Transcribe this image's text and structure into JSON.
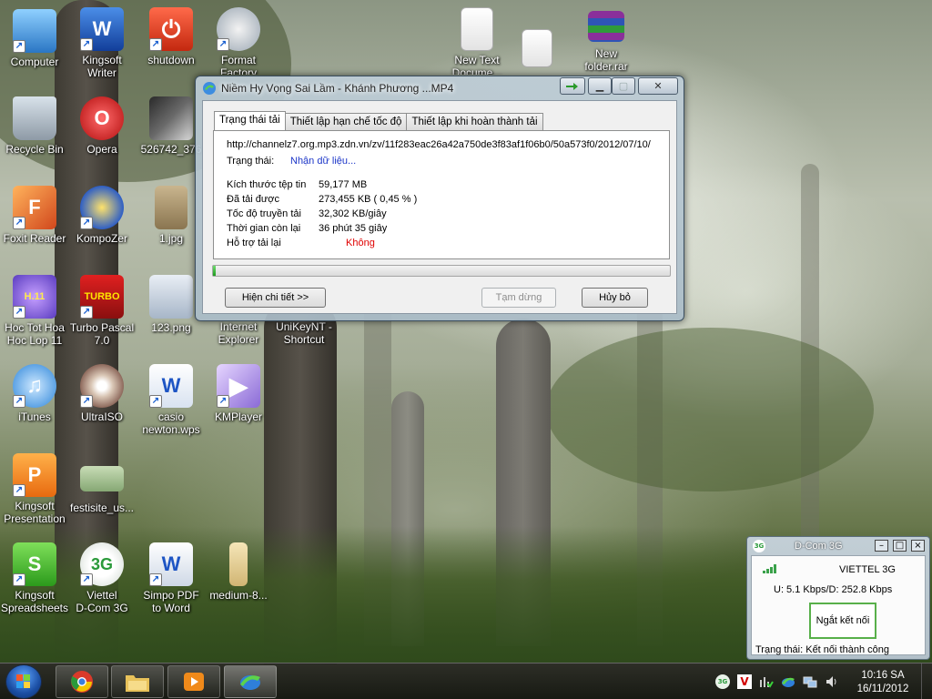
{
  "desktop": {
    "icons": [
      {
        "label": "Computer",
        "label2": ""
      },
      {
        "label": "Kingsoft",
        "label2": "Writer"
      },
      {
        "label": "shutdown",
        "label2": ""
      },
      {
        "label": "Format",
        "label2": "Factory"
      },
      {
        "label": "New Text",
        "label2": "Docume..."
      },
      {
        "label": "",
        "label2": ""
      },
      {
        "label": "New",
        "label2": "folder.rar"
      },
      {
        "label": "Recycle Bin",
        "label2": ""
      },
      {
        "label": "Opera",
        "label2": ""
      },
      {
        "label": "526742_376",
        "label2": ""
      },
      {
        "label": "Foxit Reader",
        "label2": ""
      },
      {
        "label": "KompoZer",
        "label2": ""
      },
      {
        "label": "1.jpg",
        "label2": ""
      },
      {
        "label": "Hoc Tot Hoa",
        "label2": "Hoc Lop 11"
      },
      {
        "label": "Turbo Pascal",
        "label2": "7.0"
      },
      {
        "label": "123.png",
        "label2": ""
      },
      {
        "label": "Internet",
        "label2": "Explorer"
      },
      {
        "label": "UniKeyNT -",
        "label2": "Shortcut"
      },
      {
        "label": "iTunes",
        "label2": ""
      },
      {
        "label": "UltraISO",
        "label2": ""
      },
      {
        "label": "casio",
        "label2": "newton.wps"
      },
      {
        "label": "KMPlayer",
        "label2": ""
      },
      {
        "label": "Kingsoft",
        "label2": "Presentation"
      },
      {
        "label": "festisite_us...",
        "label2": ""
      },
      {
        "label": "Kingsoft",
        "label2": "Spreadsheets"
      },
      {
        "label": "Viettel",
        "label2": "D-Com 3G"
      },
      {
        "label": "Simpo PDF",
        "label2": "to Word"
      },
      {
        "label": "medium-8...",
        "label2": ""
      }
    ],
    "icon_glyphs": {
      "word": "W",
      "opera": "O",
      "foxit": "F",
      "turbo": "TURBO",
      "kingsoft_ppt": "P",
      "kingsoft_sheet": "S",
      "dcom": "3G",
      "hoa_badge": "H.11",
      "wps": "W"
    }
  },
  "download_dialog": {
    "title": "Niềm Hy Vọng Sai Lầm - Khánh Phương ...MP4",
    "tabs": [
      "Trạng thái tải",
      "Thiết lập hạn chế tốc độ",
      "Thiết lập khi hoàn thành tải"
    ],
    "url": "http://channelz7.org.mp3.zdn.vn/zv/11f283eac26a42a750de3f83af1f06b0/50a573f0/2012/07/10/",
    "status_label": "Trạng thái:",
    "status_value": "Nhận dữ liệu...",
    "rows": [
      {
        "key": "Kích thước tệp tin",
        "value": "59,177  MB"
      },
      {
        "key": "Đã tải được",
        "value": "273,455  KB  ( 0,45 % )"
      },
      {
        "key": "Tốc độ truyền tải",
        "value": "32,302  KB/giây"
      },
      {
        "key": "Thời gian còn lại",
        "value": "36 phút 35 giây"
      },
      {
        "key": "Hỗ trợ tải lại",
        "value": "Không"
      }
    ],
    "progress_percent": 0.45,
    "buttons": {
      "details": "Hiện chi tiết >>",
      "pause": "Tạm dừng",
      "cancel": "Hủy bỏ"
    },
    "colors": {
      "status_value": "#1c36c8",
      "resume_no": "#e00000",
      "progress": "#2fb52f"
    }
  },
  "dcom": {
    "title": "D-Com 3G",
    "network": "VIETTEL  3G",
    "speed": "U: 5.1 Kbps/D: 252.8 Kbps",
    "disconnect": "Ngắt kết nối",
    "status": "Trạng thái: Kết nối thành công",
    "logo": "3G"
  },
  "taskbar": {
    "clock_time": "10:16 SA",
    "clock_date": "16/11/2012",
    "tray_badge": "V",
    "items": [
      "chrome-icon",
      "explorer-icon",
      "media-player-icon",
      "download-manager-icon"
    ]
  }
}
